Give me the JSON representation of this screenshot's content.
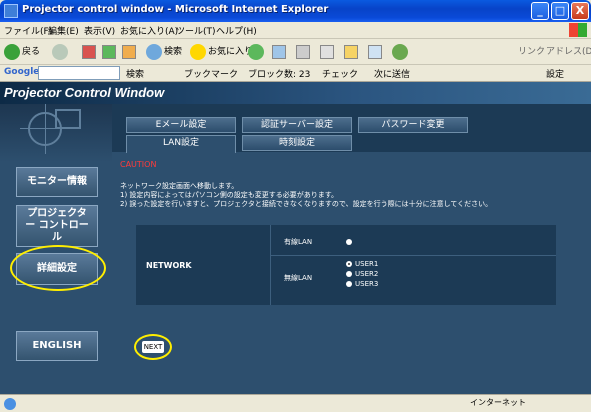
{
  "window": {
    "title": "Projector control window - Microsoft Internet Explorer",
    "buttons": {
      "minimize": "_",
      "maximize": "□",
      "close": "X"
    }
  },
  "menubar": {
    "items": [
      "ファイル(F)",
      "編集(E)",
      "表示(V)",
      "お気に入り(A)",
      "ツール(T)",
      "ヘルプ(H)"
    ]
  },
  "toolbar": {
    "back_label": "戻る",
    "search_label": "検索",
    "favorites_label": "お気に入り",
    "links_label": "リンク",
    "address_label": "アドレス(D)"
  },
  "googlebar": {
    "logo": "Google",
    "search_label": "検索",
    "bookmarks_label": "ブックマーク",
    "blocked_label": "ブロック数: 23",
    "check_label": "チェック",
    "send_label": "次に送信",
    "settings_label": "設定"
  },
  "page": {
    "banner_title": "Projector Control Window",
    "sidebar": {
      "monitor_label": "モニター情報",
      "projector_control_label": "プロジェクター コントロール",
      "advanced_label": "詳細設定",
      "english_label": "ENGLISH"
    },
    "tabs": {
      "email": "Eメール設定",
      "auth_server": "認証サーバー設定",
      "password_change": "パスワード変更",
      "lan": "LAN設定",
      "time": "時刻設定"
    },
    "caution": "CAUTION",
    "messages": [
      "ネットワーク設定画面へ移動します。",
      "1) 設定内容によってはパソコン側の設定も変更する必要があります。",
      "2) 誤った設定を行いますと、プロジェクタと接続できなくなりますので、設定を行う際には十分に注意してください。"
    ],
    "network": {
      "label": "NETWORK",
      "wired_label": "有線LAN",
      "wireless_label": "無線LAN",
      "user_options": [
        "USER1",
        "USER2",
        "USER3"
      ],
      "selected_user": "USER1"
    },
    "next_label": "NEXT"
  },
  "statusbar": {
    "zone": "インターネット"
  },
  "colors": {
    "highlight_ring": "#ffee00",
    "caution": "#ff3b3b",
    "page_bg": "#1c3a55"
  }
}
